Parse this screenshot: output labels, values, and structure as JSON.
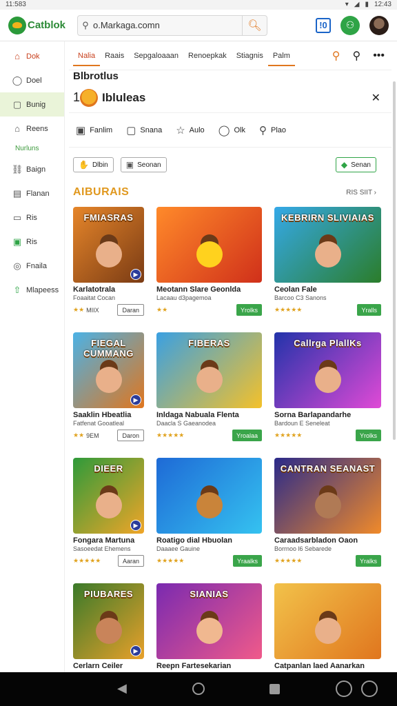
{
  "status_bar": {
    "time": "11:583",
    "clock_right": "12:43"
  },
  "header": {
    "brand": "Catblok",
    "search": {
      "value": "o.Markaga.comn",
      "placeholder": ""
    },
    "icons": [
      "search-icon",
      "badge-icon",
      "account-icon",
      "avatar"
    ]
  },
  "sidebar": {
    "items": [
      {
        "label": "Dok",
        "icon": "home-icon"
      },
      {
        "label": "Doel",
        "icon": "chat-icon"
      },
      {
        "label": "Bunig",
        "icon": "bag-icon"
      },
      {
        "label": "Reens",
        "icon": "home-outline-icon"
      }
    ],
    "section_heading": "Nurluns",
    "items2": [
      {
        "label": "Baign",
        "icon": "link-icon"
      },
      {
        "label": "Flanan",
        "icon": "chart-icon"
      },
      {
        "label": "Ris",
        "icon": "doc-icon"
      },
      {
        "label": "Ris",
        "icon": "badge-green-icon"
      },
      {
        "label": "Fnaila",
        "icon": "compass-icon"
      },
      {
        "label": "Mlapeess",
        "icon": "upload-icon"
      }
    ]
  },
  "tabs": [
    {
      "label": "Nalia"
    },
    {
      "label": "Raais"
    },
    {
      "label": "Sepgaloaaan"
    },
    {
      "label": "Renoepkak"
    },
    {
      "label": "Stiagnis"
    },
    {
      "label": "Palm"
    }
  ],
  "page_heading": "Blbrotlus",
  "subheader": {
    "number": "1",
    "title": "Ibluleas"
  },
  "filters": [
    {
      "label": "Fanlim",
      "icon": "grid-icon"
    },
    {
      "label": "Snana",
      "icon": "chat-square-icon"
    },
    {
      "label": "Aulo",
      "icon": "star-icon"
    },
    {
      "label": "Olk",
      "icon": "comment-icon"
    },
    {
      "label": "Plao",
      "icon": "search-icon"
    }
  ],
  "chips": {
    "left1": "Dlbin",
    "left2": "Seonan",
    "right": "Senan"
  },
  "section": {
    "title": "AIBURAIS",
    "more": "RIS SIIT"
  },
  "games": [
    {
      "thumb_title": "FMIASRAS",
      "name": "Karlatotrala",
      "sub": "Foaaitat Cocan",
      "stars": "★★",
      "rating": "MIIX",
      "btn": "Daran",
      "btn_style": "outline",
      "bg": [
        "#e6862a",
        "#7a3b14"
      ],
      "ch": "#e9b08a"
    },
    {
      "thumb_title": "",
      "name": "Meotann Slare Geonlda",
      "sub": "Lacaau d3pagemoa",
      "stars": "★★",
      "rating": "",
      "btn": "Yrolks",
      "btn_style": "green",
      "bg": [
        "#ff8a2a",
        "#d0301a"
      ],
      "ch": "#ffd21e"
    },
    {
      "thumb_title": "KEBRIRN SLIVIAIAS",
      "name": "Ceolan Fale",
      "sub": "Barcoo C3 Sanons",
      "stars": "★★★★★",
      "rating": "",
      "btn": "Yralls",
      "btn_style": "green",
      "bg": [
        "#35a9e8",
        "#2b7d2a"
      ],
      "ch": "#e9b08a"
    },
    {
      "thumb_title": "FIEGAL CUMMANG",
      "name": "Saaklin Hbeatlia",
      "sub": "Fatfenat Gooatleal",
      "stars": "★★",
      "rating": "9EM",
      "btn": "Daron",
      "btn_style": "outline",
      "bg": [
        "#4bb2e6",
        "#e0761e"
      ],
      "ch": "#e9b08a"
    },
    {
      "thumb_title": "FIBERAS",
      "name": "Inldaga Nabuala Flenta",
      "sub": "Daacla S Gaeanodea",
      "stars": "★★★★★",
      "rating": "",
      "btn": "Yroalaa",
      "btn_style": "green",
      "bg": [
        "#3aa0e2",
        "#f4c12a"
      ],
      "ch": "#e9b08a"
    },
    {
      "thumb_title": "Callrga PlallKs",
      "name": "Sorna Barlapandarhe",
      "sub": "Bardoun E Seneleat",
      "stars": "★★★★★",
      "rating": "",
      "btn": "Yrolks",
      "btn_style": "green",
      "bg": [
        "#2233aa",
        "#e04ad6"
      ],
      "ch": "#e9b08a"
    },
    {
      "thumb_title": "DIEER",
      "name": "Fongara Martuna",
      "sub": "Sasoeedat Ehemens",
      "stars": "★★★★★",
      "rating": "",
      "btn": "Aaran",
      "btn_style": "outline",
      "bg": [
        "#2e9a3a",
        "#f0a528"
      ],
      "ch": "#e9b08a"
    },
    {
      "thumb_title": "",
      "name": "Roatigo dial Hbuolan",
      "sub": "Daaaee Gauine",
      "stars": "★★★★★",
      "rating": "",
      "btn": "Yraalks",
      "btn_style": "green",
      "bg": [
        "#1e6ad6",
        "#35c2f0"
      ],
      "ch": "#c9843a"
    },
    {
      "thumb_title": "CANTRAN SEANAST",
      "name": "Caraadsarbladon Oaon",
      "sub": "Borrnoo l6 Sebarede",
      "stars": "★★★★★",
      "rating": "",
      "btn": "Yralks",
      "btn_style": "green",
      "bg": [
        "#2a2a8a",
        "#f08a2a"
      ],
      "ch": "#b07a55"
    },
    {
      "thumb_title": "PIUBARES",
      "name": "Cerlarn Ceiler",
      "sub": "",
      "stars": "",
      "rating": "",
      "btn": "",
      "btn_style": "none",
      "bg": [
        "#3a7a2a",
        "#e8a02a"
      ],
      "ch": "#c9845a"
    },
    {
      "thumb_title": "SIANIAS",
      "name": "Reepn Fartesekarian",
      "sub": "",
      "stars": "",
      "rating": "",
      "btn": "",
      "btn_style": "none",
      "bg": [
        "#7a2ab0",
        "#f05a8a"
      ],
      "ch": "#f0b890"
    },
    {
      "thumb_title": "",
      "name": "Catpanlan laed Aanarkan",
      "sub": "",
      "stars": "",
      "rating": "",
      "btn": "",
      "btn_style": "none",
      "bg": [
        "#f2c24a",
        "#e0761e"
      ],
      "ch": "#e9b08a"
    }
  ]
}
